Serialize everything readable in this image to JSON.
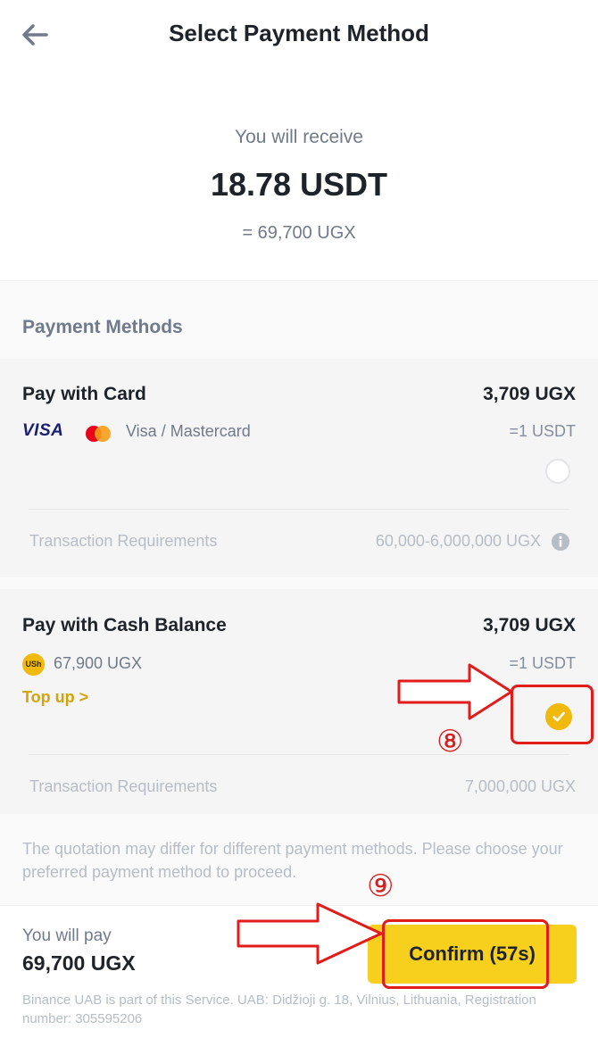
{
  "header": {
    "title": "Select Payment Method",
    "back_icon": "arrow-left-icon"
  },
  "receive": {
    "label": "You will receive",
    "amount": "18.78 USDT",
    "equivalent": "= 69,700 UGX"
  },
  "methods_label": "Payment Methods",
  "methods": [
    {
      "title": "Pay with Card",
      "price": "3,709 UGX",
      "visa_text": "VISA",
      "sub": "Visa / Mastercard",
      "eq": "=1 USDT",
      "selected": false,
      "req_label": "Transaction Requirements",
      "req_value": "60,000-6,000,000 UGX",
      "info_icon": "info-icon"
    },
    {
      "title": "Pay with Cash Balance",
      "price": "3,709 UGX",
      "badge": "USh",
      "sub": "67,900 UGX",
      "eq": "=1 USDT",
      "topup": "Top up >",
      "selected": true,
      "req_label": "Transaction Requirements",
      "req_value": "7,000,000 UGX"
    }
  ],
  "note": "The quotation may differ for different payment methods. Please choose your preferred payment method to proceed.",
  "bottom": {
    "pay_label": "You will pay",
    "pay_amount": "69,700 UGX",
    "confirm_label": "Confirm (57s)"
  },
  "footer": "Binance UAB is part of this Service. UAB: Didžioji g. 18, Vilnius, Lithuania, Registration number: 305595206",
  "annotations": {
    "step8": "⑧",
    "step9": "⑨",
    "highlight_color": "#e21b1b"
  },
  "colors": {
    "accent": "#f0b90b",
    "button": "#f7cf1d"
  }
}
